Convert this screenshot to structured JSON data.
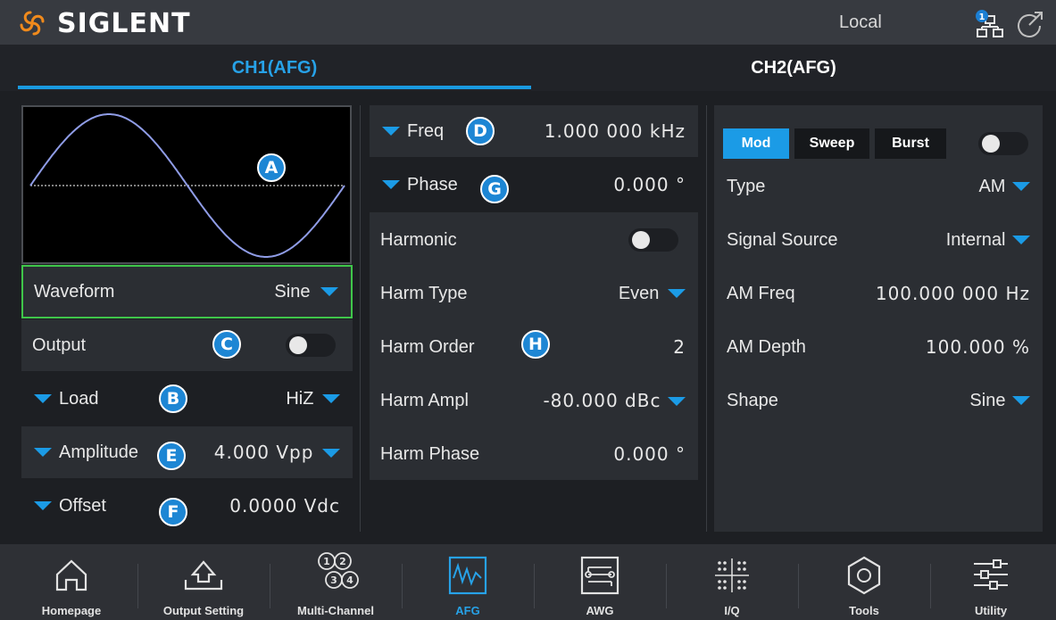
{
  "header": {
    "brand": "SIGLENT",
    "status": "Local",
    "network_badge": "1"
  },
  "tabs": [
    {
      "label": "CH1(AFG)",
      "active": true
    },
    {
      "label": "CH2(AFG)",
      "active": false
    }
  ],
  "left": {
    "waveform": {
      "label": "Waveform",
      "value": "Sine"
    },
    "output": {
      "label": "Output",
      "on": false
    },
    "load": {
      "label": "Load",
      "value": "HiZ"
    },
    "amplitude": {
      "label": "Amplitude",
      "value": "4.000 Vpp"
    },
    "offset": {
      "label": "Offset",
      "value": "0.0000 Vdc"
    }
  },
  "middle": {
    "freq": {
      "label": "Freq",
      "value": "1.000 000 kHz"
    },
    "phase": {
      "label": "Phase",
      "value": "0.000 °"
    },
    "harmonic": {
      "label": "Harmonic",
      "on": false
    },
    "harm_type": {
      "label": "Harm Type",
      "value": "Even"
    },
    "harm_order": {
      "label": "Harm Order",
      "value": "2"
    },
    "harm_ampl": {
      "label": "Harm Ampl",
      "value": "-80.000 dBc"
    },
    "harm_phase": {
      "label": "Harm Phase",
      "value": "0.000 °"
    }
  },
  "right": {
    "modes": [
      {
        "label": "Mod",
        "active": true
      },
      {
        "label": "Sweep",
        "active": false
      },
      {
        "label": "Burst",
        "active": false
      }
    ],
    "mode_enabled": false,
    "type": {
      "label": "Type",
      "value": "AM"
    },
    "signal_source": {
      "label": "Signal Source",
      "value": "Internal"
    },
    "am_freq": {
      "label": "AM Freq",
      "value": "100.000 000 Hz"
    },
    "am_depth": {
      "label": "AM Depth",
      "value": "100.000 %"
    },
    "shape": {
      "label": "Shape",
      "value": "Sine"
    }
  },
  "annotations": {
    "a": "A",
    "b": "B",
    "c": "C",
    "d": "D",
    "e": "E",
    "f": "F",
    "g": "G",
    "h": "H"
  },
  "nav": [
    {
      "label": "Homepage",
      "icon": "home-icon"
    },
    {
      "label": "Output Setting",
      "icon": "output-setting-icon"
    },
    {
      "label": "Multi-Channel",
      "icon": "multi-channel-icon"
    },
    {
      "label": "AFG",
      "icon": "afg-waveform-icon",
      "active": true
    },
    {
      "label": "AWG",
      "icon": "awg-icon"
    },
    {
      "label": "I/Q",
      "icon": "iq-constellation-icon"
    },
    {
      "label": "Tools",
      "icon": "tools-hex-nut-icon"
    },
    {
      "label": "Utility",
      "icon": "utility-sliders-icon"
    }
  ],
  "colors": {
    "accent": "#1b9be6",
    "selected_border": "#3fc64a",
    "waveform": "#8f9ce6"
  }
}
